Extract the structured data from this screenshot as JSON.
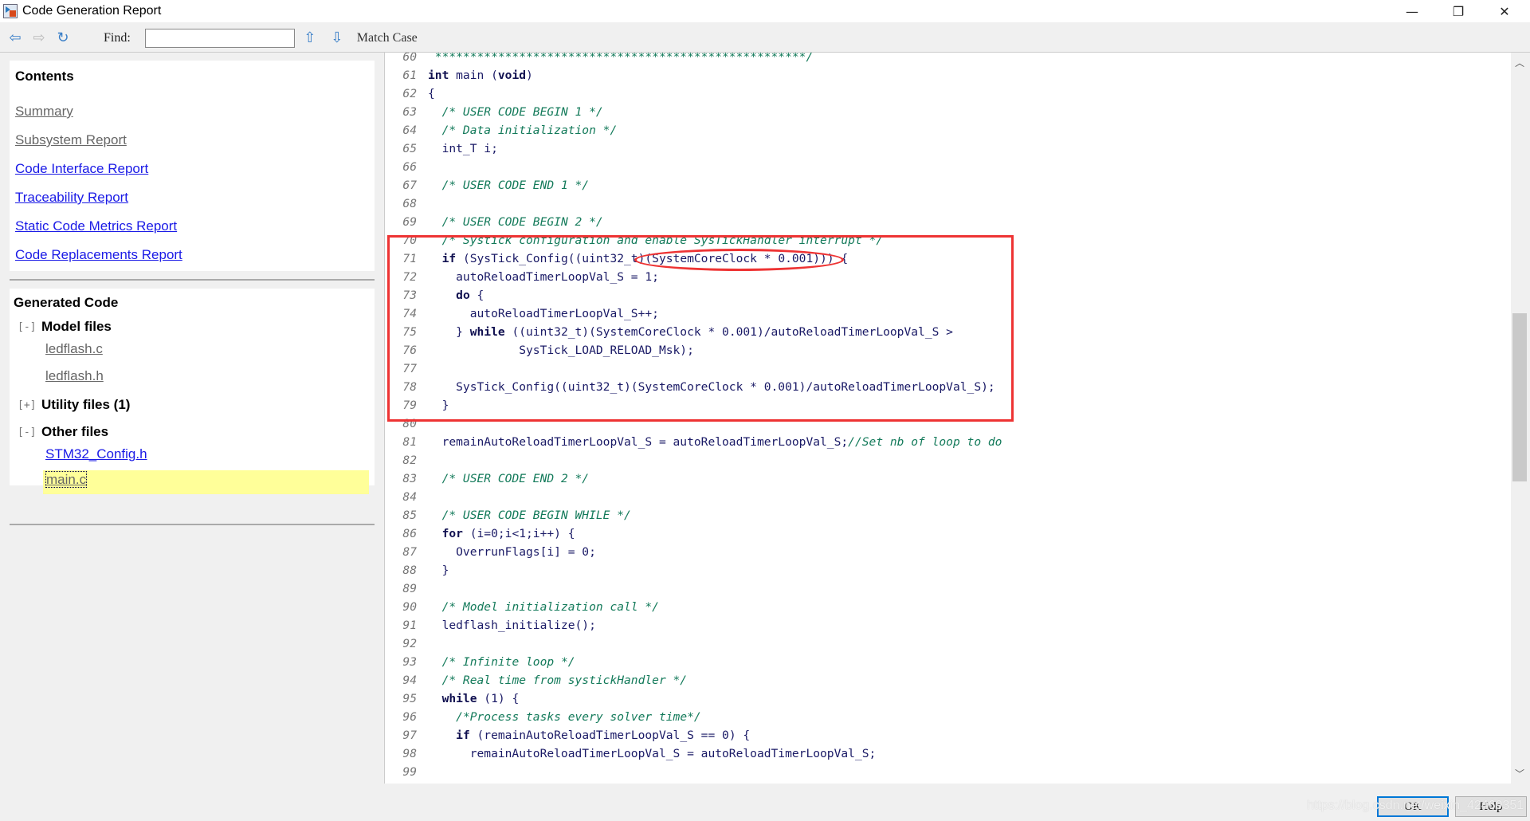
{
  "window": {
    "title": "Code Generation Report",
    "minimize": "—",
    "restore": "❐",
    "close": "✕"
  },
  "toolbar": {
    "find_label": "Find:",
    "find_value": "",
    "match_case": "Match Case"
  },
  "contents": {
    "title": "Contents",
    "links": [
      {
        "label": "Summary",
        "visited": true
      },
      {
        "label": "Subsystem Report",
        "visited": true
      },
      {
        "label": "Code Interface Report",
        "visited": false
      },
      {
        "label": "Traceability Report",
        "visited": false
      },
      {
        "label": "Static Code Metrics Report",
        "visited": false
      },
      {
        "label": "Code Replacements Report",
        "visited": false
      }
    ]
  },
  "generated": {
    "title": "Generated Code",
    "model": {
      "toggle": "[-]",
      "label": "Model files",
      "files": [
        "ledflash.c",
        "ledflash.h"
      ]
    },
    "utility": {
      "toggle": "[+]",
      "label": "Utility files (1)"
    },
    "other": {
      "toggle": "[-]",
      "label": "Other files",
      "files": [
        "STM32_Config.h",
        "main.c"
      ],
      "selected": "main.c"
    }
  },
  "code": [
    {
      "n": "60",
      "s": [
        [
          "c",
          " *****************************************************/"
        ]
      ]
    },
    {
      "n": "61",
      "s": [
        [
          "k",
          "int"
        ],
        [
          "n",
          " main ("
        ],
        [
          "k",
          "void"
        ],
        [
          "n",
          ")"
        ]
      ]
    },
    {
      "n": "62",
      "s": [
        [
          "n",
          "{"
        ]
      ]
    },
    {
      "n": "63",
      "s": [
        [
          "n",
          "  "
        ],
        [
          "c",
          "/* USER CODE BEGIN 1 */"
        ]
      ]
    },
    {
      "n": "64",
      "s": [
        [
          "n",
          "  "
        ],
        [
          "c",
          "/* Data initialization */"
        ]
      ]
    },
    {
      "n": "65",
      "s": [
        [
          "n",
          "  int_T i;"
        ]
      ]
    },
    {
      "n": "66",
      "s": []
    },
    {
      "n": "67",
      "s": [
        [
          "n",
          "  "
        ],
        [
          "c",
          "/* USER CODE END 1 */"
        ]
      ]
    },
    {
      "n": "68",
      "s": []
    },
    {
      "n": "69",
      "s": [
        [
          "n",
          "  "
        ],
        [
          "c",
          "/* USER CODE BEGIN 2 */"
        ]
      ]
    },
    {
      "n": "70",
      "s": [
        [
          "n",
          "  "
        ],
        [
          "c",
          "/* Systick configuration and enable SysTickHandler interrupt */"
        ]
      ]
    },
    {
      "n": "71",
      "s": [
        [
          "n",
          "  "
        ],
        [
          "k",
          "if"
        ],
        [
          "n",
          " (SysTick_Config((uint32_t)(SystemCoreClock * 0.001))) {"
        ]
      ]
    },
    {
      "n": "72",
      "s": [
        [
          "n",
          "    autoReloadTimerLoopVal_S = 1;"
        ]
      ]
    },
    {
      "n": "73",
      "s": [
        [
          "n",
          "    "
        ],
        [
          "k",
          "do"
        ],
        [
          "n",
          " {"
        ]
      ]
    },
    {
      "n": "74",
      "s": [
        [
          "n",
          "      autoReloadTimerLoopVal_S++;"
        ]
      ]
    },
    {
      "n": "75",
      "s": [
        [
          "n",
          "    } "
        ],
        [
          "k",
          "while"
        ],
        [
          "n",
          " ((uint32_t)(SystemCoreClock * 0.001)/autoReloadTimerLoopVal_S >"
        ]
      ]
    },
    {
      "n": "76",
      "s": [
        [
          "n",
          "             SysTick_LOAD_RELOAD_Msk);"
        ]
      ]
    },
    {
      "n": "77",
      "s": []
    },
    {
      "n": "78",
      "s": [
        [
          "n",
          "    SysTick_Config((uint32_t)(SystemCoreClock * 0.001)/autoReloadTimerLoopVal_S);"
        ]
      ]
    },
    {
      "n": "79",
      "s": [
        [
          "n",
          "  }"
        ]
      ]
    },
    {
      "n": "80",
      "s": []
    },
    {
      "n": "81",
      "s": [
        [
          "n",
          "  remainAutoReloadTimerLoopVal_S = autoReloadTimerLoopVal_S;"
        ],
        [
          "c",
          "//Set nb of loop to do"
        ]
      ]
    },
    {
      "n": "82",
      "s": []
    },
    {
      "n": "83",
      "s": [
        [
          "n",
          "  "
        ],
        [
          "c",
          "/* USER CODE END 2 */"
        ]
      ]
    },
    {
      "n": "84",
      "s": []
    },
    {
      "n": "85",
      "s": [
        [
          "n",
          "  "
        ],
        [
          "c",
          "/* USER CODE BEGIN WHILE */"
        ]
      ]
    },
    {
      "n": "86",
      "s": [
        [
          "n",
          "  "
        ],
        [
          "k",
          "for"
        ],
        [
          "n",
          " (i=0;i<1;i++) {"
        ]
      ]
    },
    {
      "n": "87",
      "s": [
        [
          "n",
          "    OverrunFlags[i] = 0;"
        ]
      ]
    },
    {
      "n": "88",
      "s": [
        [
          "n",
          "  }"
        ]
      ]
    },
    {
      "n": "89",
      "s": []
    },
    {
      "n": "90",
      "s": [
        [
          "n",
          "  "
        ],
        [
          "c",
          "/* Model initialization call */"
        ]
      ]
    },
    {
      "n": "91",
      "s": [
        [
          "n",
          "  ledflash_initialize();"
        ]
      ]
    },
    {
      "n": "92",
      "s": []
    },
    {
      "n": "93",
      "s": [
        [
          "n",
          "  "
        ],
        [
          "c",
          "/* Infinite loop */"
        ]
      ]
    },
    {
      "n": "94",
      "s": [
        [
          "n",
          "  "
        ],
        [
          "c",
          "/* Real time from systickHandler */"
        ]
      ]
    },
    {
      "n": "95",
      "s": [
        [
          "n",
          "  "
        ],
        [
          "k",
          "while"
        ],
        [
          "n",
          " (1) {"
        ]
      ]
    },
    {
      "n": "96",
      "s": [
        [
          "n",
          "    "
        ],
        [
          "c",
          "/*Process tasks every solver time*/"
        ]
      ]
    },
    {
      "n": "97",
      "s": [
        [
          "n",
          "    "
        ],
        [
          "k",
          "if"
        ],
        [
          "n",
          " (remainAutoReloadTimerLoopVal_S == 0) {"
        ]
      ]
    },
    {
      "n": "98",
      "s": [
        [
          "n",
          "      remainAutoReloadTimerLoopVal_S = autoReloadTimerLoopVal_S;"
        ]
      ]
    },
    {
      "n": "99",
      "s": []
    }
  ],
  "annotation_color": "#ee3333",
  "scroll": {
    "position_fraction": 0.46
  },
  "buttons": {
    "ok": "OK",
    "help": "Help"
  },
  "watermark": "https://blog.csdn.net/weixin_42469351"
}
